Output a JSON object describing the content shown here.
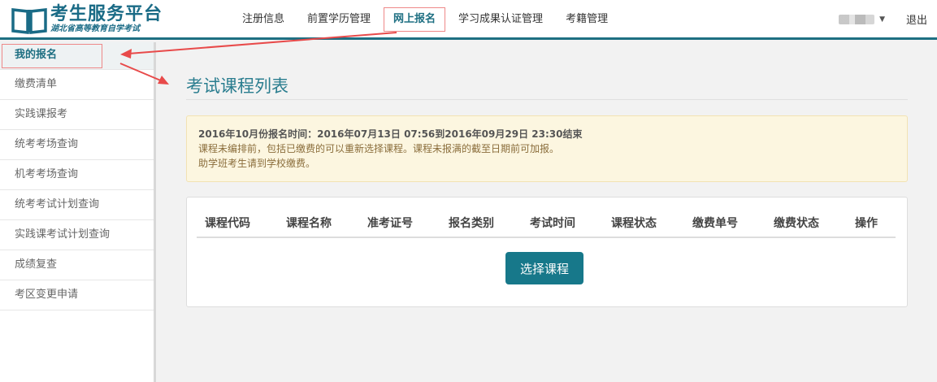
{
  "logo": {
    "title": "考生服务平台",
    "subtitle": "湖北省高等教育自学考试"
  },
  "nav": {
    "items": [
      {
        "label": "注册信息",
        "active": false
      },
      {
        "label": "前置学历管理",
        "active": false
      },
      {
        "label": "网上报名",
        "active": true
      },
      {
        "label": "学习成果认证管理",
        "active": false
      },
      {
        "label": "考籍管理",
        "active": false
      }
    ]
  },
  "user": {
    "logout_label": "退出"
  },
  "sidebar": {
    "items": [
      {
        "label": "我的报名",
        "active": true
      },
      {
        "label": "缴费清单",
        "active": false
      },
      {
        "label": "实践课报考",
        "active": false
      },
      {
        "label": "统考考场查询",
        "active": false
      },
      {
        "label": "机考考场查询",
        "active": false
      },
      {
        "label": "统考考试计划查询",
        "active": false
      },
      {
        "label": "实践课考试计划查询",
        "active": false
      },
      {
        "label": "成绩复查",
        "active": false
      },
      {
        "label": "考区变更申请",
        "active": false
      }
    ]
  },
  "main": {
    "title": "考试课程列表",
    "notice": {
      "line1": "2016年10月份报名时间：2016年07月13日 07:56到2016年09月29日 23:30结束",
      "line2": "课程未编排前，包括已缴费的可以重新选择课程。课程未报满的截至日期前可加报。",
      "line3": "助学班考生请到学校缴费。"
    },
    "table": {
      "columns": [
        "课程代码",
        "课程名称",
        "准考证号",
        "报名类别",
        "考试时间",
        "课程状态",
        "缴费单号",
        "缴费状态",
        "操作"
      ]
    },
    "select_button_label": "选择课程"
  },
  "colors": {
    "brand": "#1a6b86",
    "accent": "#17788a",
    "notice_bg": "#fcf6e0",
    "annotation": "#e84a4a"
  }
}
